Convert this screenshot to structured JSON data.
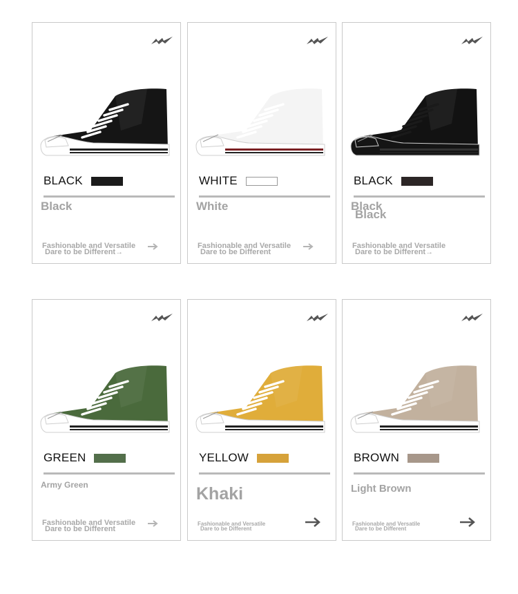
{
  "cards": [
    {
      "color_label": "BLACK",
      "swatch": "#1b1b1b",
      "variant_line1": "Black",
      "variant_line2": "",
      "tagline1": "Fashionable and Versatile",
      "tagline2": "Dare to be Different→",
      "upper": "#151515",
      "sole": "#ffffff",
      "stripe": "#202020",
      "laces": "#ffffff"
    },
    {
      "color_label": "WHITE",
      "swatch": "#ffffff",
      "variant_line1": "White",
      "variant_line2": "",
      "tagline1": "Fashionable and Versatile",
      "tagline2": "Dare to be Different",
      "upper": "#f4f4f4",
      "sole": "#ffffff",
      "stripe": "#7a1f22",
      "laces": "#ffffff"
    },
    {
      "color_label": "BLACK",
      "swatch": "#2c2626",
      "variant_line1": "Black",
      "variant_line2": "Black",
      "tagline1": "Fashionable and Versatile",
      "tagline2": "Dare to be Different→",
      "upper": "#121212",
      "sole": "#151515",
      "stripe": "#333333",
      "laces": "#1a1a1a"
    },
    {
      "color_label": "GREEN",
      "swatch": "#536f4b",
      "variant_line1": "Army Green",
      "variant_line2": "",
      "tagline1": "Fashionable and Versatile",
      "tagline2": "Dare to be Different",
      "upper": "#4a6a3c",
      "sole": "#ffffff",
      "stripe": "#202020",
      "laces": "#ffffff"
    },
    {
      "color_label": "YELLOW",
      "swatch": "#d6a23a",
      "variant_line1": "Khaki",
      "variant_line2": "",
      "tagline1": "Fashionable and Versatile",
      "tagline2": "Dare to be Different",
      "upper": "#e0ad3a",
      "sole": "#ffffff",
      "stripe": "#202020",
      "laces": "#ffffff"
    },
    {
      "color_label": "BROWN",
      "swatch": "#a7978a",
      "variant_line1": "Light Brown",
      "variant_line2": "",
      "tagline1": "Fashionable and Versatile",
      "tagline2": "Dare to be Different",
      "upper": "#c2b19e",
      "sole": "#ffffff",
      "stripe": "#202020",
      "laces": "#ffffff"
    }
  ],
  "icons": {
    "logo": "brand-logo-icon",
    "shoe": "sneaker-icon",
    "arrow": "arrow-right-icon"
  }
}
